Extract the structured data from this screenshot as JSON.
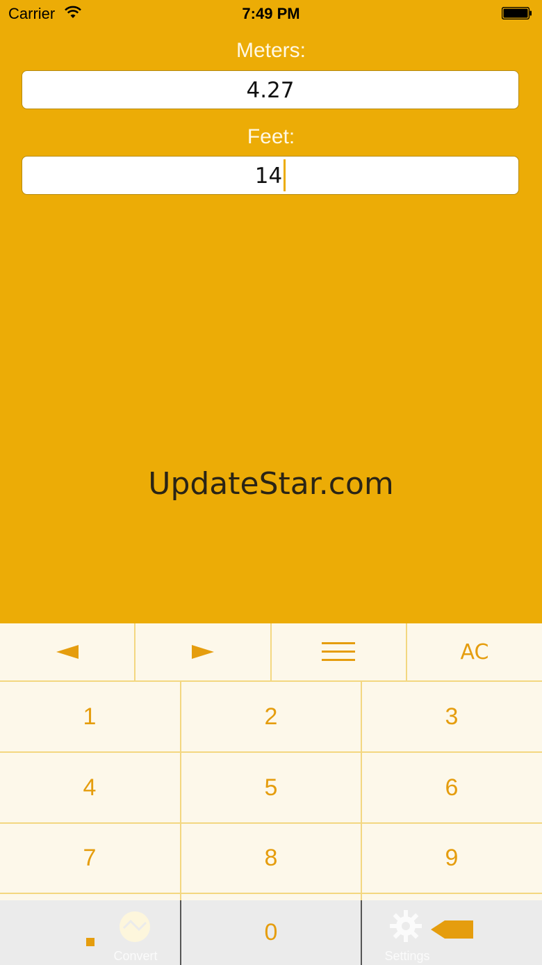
{
  "status_bar": {
    "carrier": "Carrier",
    "time": "7:49 PM"
  },
  "converter": {
    "meters_label": "Meters:",
    "meters_value": "4.27",
    "feet_label": "Feet:",
    "feet_value": "14"
  },
  "brand_text": "UpdateStar.com",
  "keypad": {
    "top_row": {
      "left_arrow": "◄",
      "right_arrow": "►",
      "menu_icon": "menu-icon",
      "clear": "AC"
    },
    "digits": [
      "1",
      "2",
      "3",
      "4",
      "5",
      "6",
      "7",
      "8",
      "9"
    ],
    "decimal": ".",
    "zero": "0"
  },
  "tabs": {
    "convert_label": "Convert",
    "settings_label": "Settings"
  },
  "colors": {
    "background": "#ecac06",
    "accent": "#e59d0e",
    "keypad_bg": "#fdf8ea",
    "separator": "#f3d780"
  }
}
